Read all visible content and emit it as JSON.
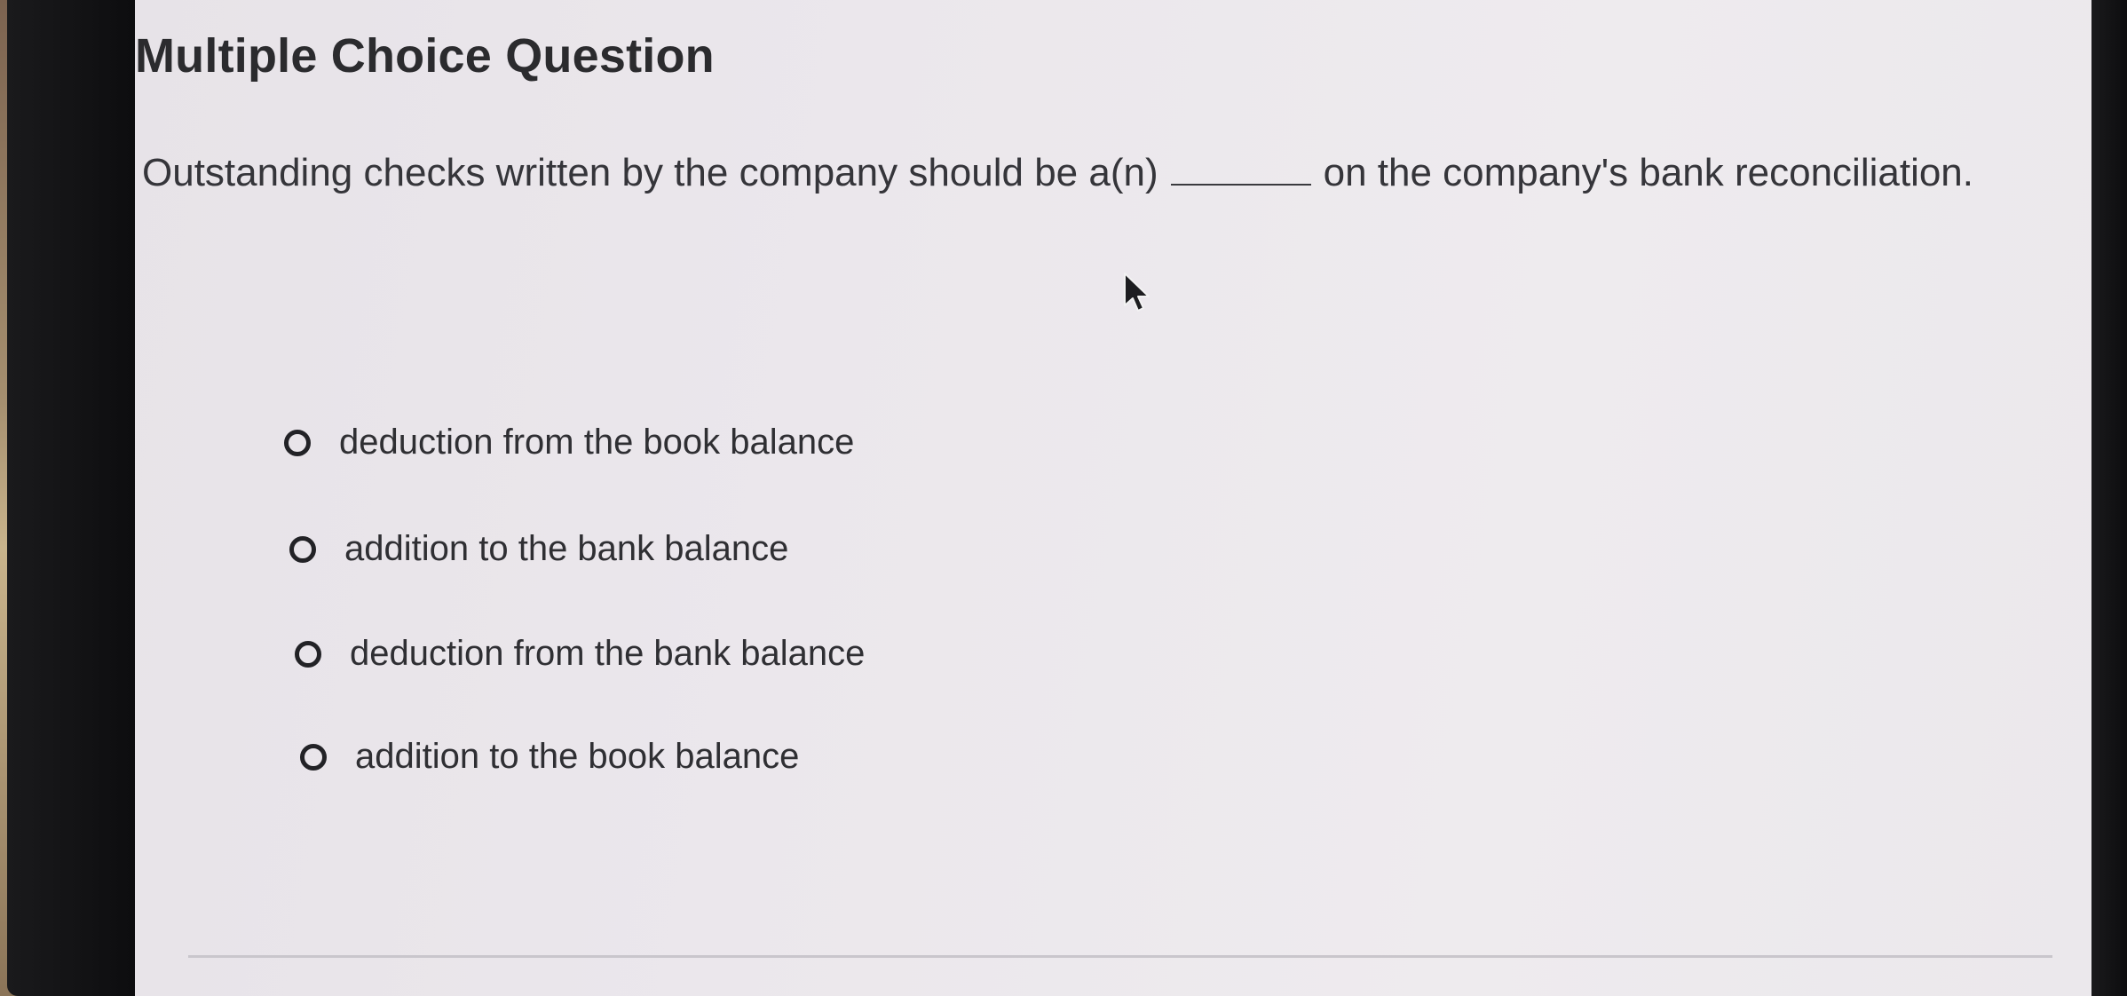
{
  "question": {
    "heading": "Multiple Choice Question",
    "prompt_before": "Outstanding checks written by the company should be a(n)",
    "prompt_after": "on the company's bank reconciliation.",
    "options": [
      {
        "label": "deduction from the book balance",
        "selected": false
      },
      {
        "label": "addition to the bank balance",
        "selected": false
      },
      {
        "label": "deduction from the bank balance",
        "selected": false
      },
      {
        "label": "addition to the book balance",
        "selected": false
      }
    ]
  },
  "icons": {
    "cursor": "mouse-pointer-icon",
    "radio": "radio-unselected-icon"
  },
  "colors": {
    "screen_background": "#ebe7ec",
    "text": "#2f2f33",
    "radio_border": "#222226"
  }
}
